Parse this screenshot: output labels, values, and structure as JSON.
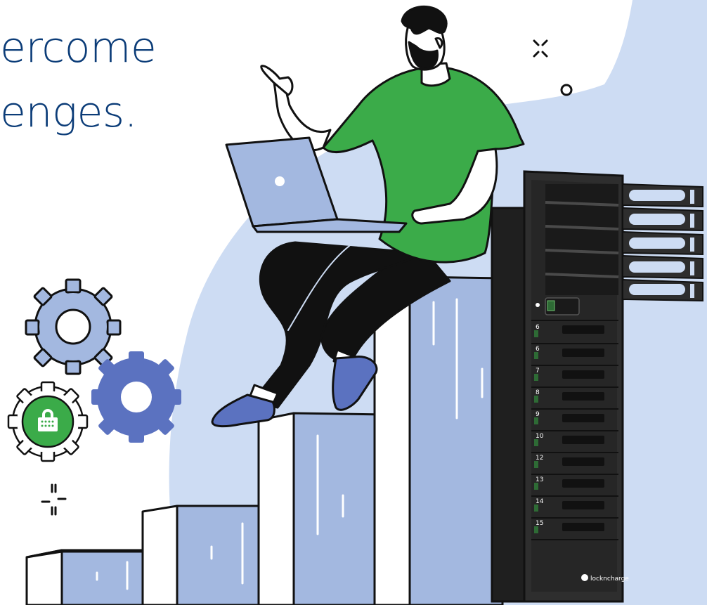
{
  "headline": {
    "line1": "ercome",
    "line2": "enges."
  },
  "brand": {
    "label": "lockncharge"
  },
  "locker": {
    "slots": [
      "6",
      "6",
      "7",
      "8",
      "9",
      "10",
      "12",
      "13",
      "14",
      "15"
    ]
  },
  "colors": {
    "headline": "#0b3c78",
    "backdrop": "#cddcf3",
    "block": "#a3b8e0",
    "shirt": "#3bab49",
    "gear_light": "#a3b8e0",
    "gear_dark": "#5b72c0",
    "locker_body": "#2e2e2e",
    "outline": "#111111"
  }
}
